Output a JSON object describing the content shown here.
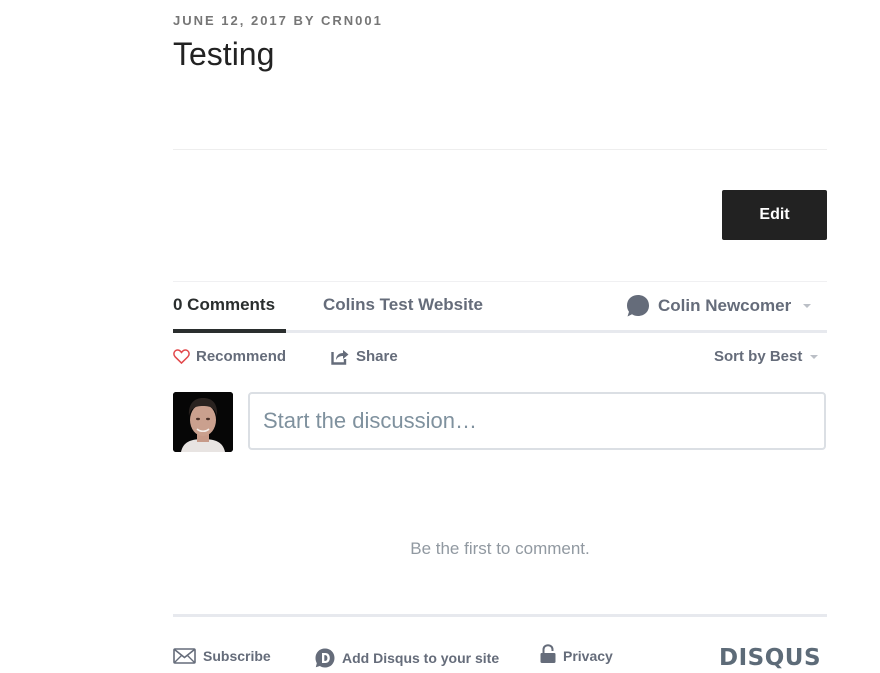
{
  "post": {
    "meta": "JUNE 12, 2017 BY CRN001",
    "title": "Testing",
    "edit_label": "Edit"
  },
  "disqus": {
    "tabs": {
      "comments": "0 Comments",
      "site": "Colins Test Website"
    },
    "user": {
      "name": "Colin Newcomer",
      "icon": "speech-bubble-icon"
    },
    "actions": {
      "recommend": "Recommend",
      "recommend_icon": "heart-icon",
      "share": "Share",
      "share_icon": "share-icon",
      "sort": "Sort by Best"
    },
    "composer": {
      "placeholder": "Start the discussion…",
      "avatar": "user-avatar"
    },
    "empty_message": "Be the first to comment.",
    "footer": {
      "subscribe": "Subscribe",
      "add_disqus": "Add Disqus to your site",
      "privacy": "Privacy",
      "logo": "DISQUS"
    },
    "colors": {
      "text_primary": "#2a2e2e",
      "text_secondary": "#656c7a",
      "heart": "#e2474a",
      "button_dark": "#222222"
    }
  }
}
